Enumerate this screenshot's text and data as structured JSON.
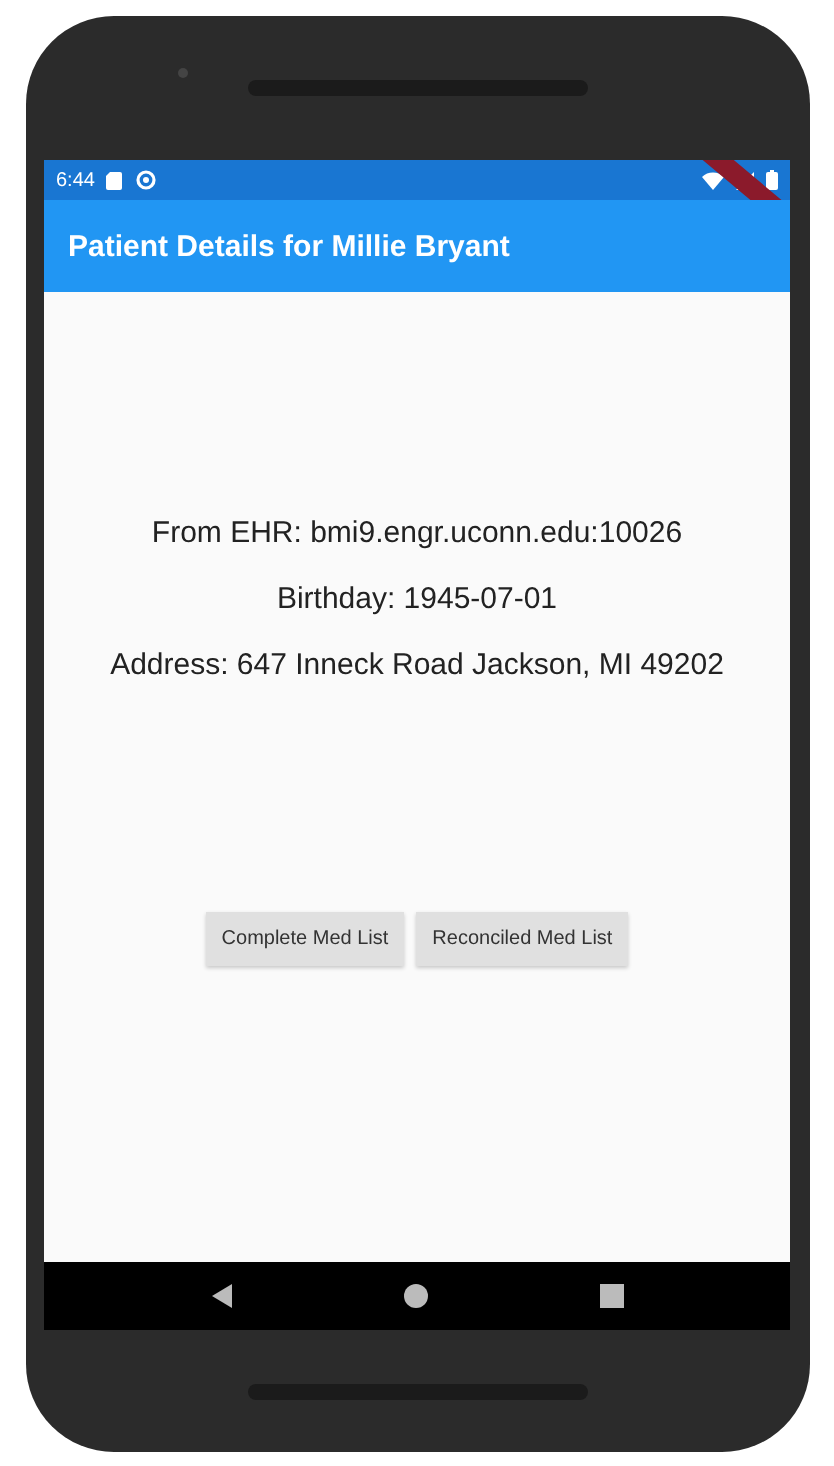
{
  "status_bar": {
    "time": "6:44"
  },
  "app_bar": {
    "title": "Patient Details for Millie Bryant"
  },
  "details": [
    "From EHR: bmi9.engr.uconn.edu:10026",
    "Birthday: 1945-07-01",
    "Address: 647 Inneck Road Jackson, MI 49202"
  ],
  "buttons": [
    "Complete Med List",
    "Reconciled Med List"
  ]
}
